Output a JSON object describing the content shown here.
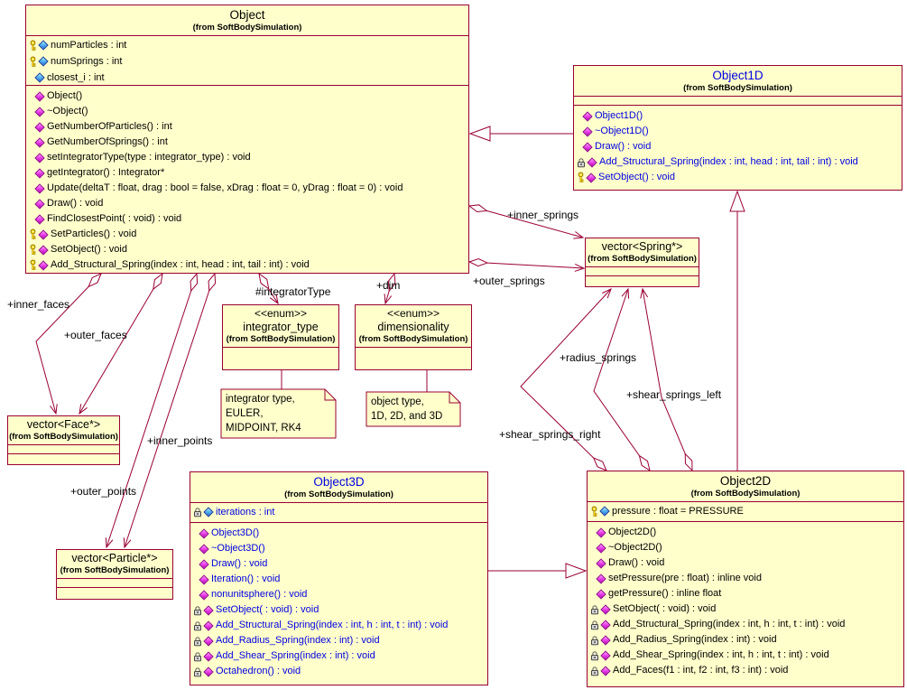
{
  "palette": {
    "box_fill": "#FFFFCC",
    "line_color": "#990033",
    "blue_text": "#0000E0",
    "black_text": "#000000",
    "note_fill": "#FFFFCC"
  },
  "classes": {
    "object": {
      "name": "Object",
      "from": "(from SoftBodySimulation)",
      "name_color": "#000000",
      "text_color": "#000000",
      "attributes": [
        {
          "icons": [
            "key",
            "attr"
          ],
          "text": "numParticles : int"
        },
        {
          "icons": [
            "key",
            "attr"
          ],
          "text": "numSprings : int"
        },
        {
          "icons": [
            "attr"
          ],
          "text": "closest_i : int"
        }
      ],
      "operations": [
        {
          "icons": [
            "op"
          ],
          "text": "Object()"
        },
        {
          "icons": [
            "op"
          ],
          "text": "~Object()"
        },
        {
          "icons": [
            "op"
          ],
          "text": "GetNumberOfParticles() : int"
        },
        {
          "icons": [
            "op"
          ],
          "text": "GetNumberOfSprings() : int"
        },
        {
          "icons": [
            "op"
          ],
          "text": "setIntegratorType(type : integrator_type) : void"
        },
        {
          "icons": [
            "op"
          ],
          "text": "getIntegrator() : Integrator*"
        },
        {
          "icons": [
            "op"
          ],
          "text": "Update(deltaT : float, drag : bool = false, xDrag : float = 0, yDrag : float = 0) : void"
        },
        {
          "icons": [
            "op"
          ],
          "text": "Draw() : void"
        },
        {
          "icons": [
            "op"
          ],
          "text": "FindClosestPoint( : void) : void"
        },
        {
          "icons": [
            "key",
            "op"
          ],
          "text": "SetParticles() : void"
        },
        {
          "icons": [
            "key",
            "op"
          ],
          "text": "SetObject() : void"
        },
        {
          "icons": [
            "key",
            "op"
          ],
          "text": "Add_Structural_Spring(index : int, head : int, tail : int) : void"
        }
      ]
    },
    "object1d": {
      "name": "Object1D",
      "from": "(from SoftBodySimulation)",
      "name_color": "#0000E0",
      "text_color": "#0000E0",
      "attributes": [],
      "operations": [
        {
          "icons": [
            "op"
          ],
          "text": "Object1D()"
        },
        {
          "icons": [
            "op"
          ],
          "text": "~Object1D()"
        },
        {
          "icons": [
            "op"
          ],
          "text": "Draw() : void"
        },
        {
          "icons": [
            "lock",
            "op"
          ],
          "text": "Add_Structural_Spring(index : int, head : int, tail : int) : void"
        },
        {
          "icons": [
            "key",
            "op"
          ],
          "text": "SetObject() : void"
        }
      ]
    },
    "vector_spring": {
      "name": "vector<Spring*>",
      "from": "(from SoftBodySimulation)",
      "name_color": "#000000",
      "text_color": "#000000",
      "attributes": [],
      "operations": []
    },
    "vector_face": {
      "name": "vector<Face*>",
      "from": "(from SoftBodySimulation)",
      "name_color": "#000000",
      "text_color": "#000000",
      "attributes": [],
      "operations": []
    },
    "vector_particle": {
      "name": "vector<Particle*>",
      "from": "(from SoftBodySimulation)",
      "name_color": "#000000",
      "text_color": "#000000",
      "attributes": [],
      "operations": []
    },
    "enum_integrator": {
      "stereotype": "<<enum>>",
      "name": "integrator_type",
      "from": "(from SoftBodySimulation)",
      "name_color": "#000000",
      "text_color": "#000000",
      "attributes": [],
      "operations": []
    },
    "enum_dimensionality": {
      "stereotype": "<<enum>>",
      "name": "dimensionality",
      "from": "(from SoftBodySimulation)",
      "name_color": "#000000",
      "text_color": "#000000",
      "attributes": [],
      "operations": []
    },
    "object3d": {
      "name": "Object3D",
      "from": "(from SoftBodySimulation)",
      "name_color": "#0000E0",
      "text_color": "#0000E0",
      "attributes": [
        {
          "icons": [
            "lock",
            "attr"
          ],
          "text": "iterations : int"
        }
      ],
      "operations": [
        {
          "icons": [
            "op"
          ],
          "text": "Object3D()"
        },
        {
          "icons": [
            "op"
          ],
          "text": "~Object3D()"
        },
        {
          "icons": [
            "op"
          ],
          "text": "Draw() : void"
        },
        {
          "icons": [
            "op"
          ],
          "text": "Iteration() : void"
        },
        {
          "icons": [
            "op"
          ],
          "text": "nonunitsphere() : void"
        },
        {
          "icons": [
            "lock",
            "op"
          ],
          "text": "SetObject( : void) : void"
        },
        {
          "icons": [
            "lock",
            "op"
          ],
          "text": "Add_Structural_Spring(index : int, h : int, t : int) : void"
        },
        {
          "icons": [
            "lock",
            "op"
          ],
          "text": "Add_Radius_Spring(index : int) : void"
        },
        {
          "icons": [
            "lock",
            "op"
          ],
          "text": "Add_Shear_Spring(index : int) : void"
        },
        {
          "icons": [
            "lock",
            "op"
          ],
          "text": "Octahedron() : void"
        }
      ]
    },
    "object2d": {
      "name": "Object2D",
      "from": "(from SoftBodySimulation)",
      "name_color": "#000000",
      "text_color": "#000000",
      "attributes": [
        {
          "icons": [
            "key",
            "attr"
          ],
          "text": "pressure : float = PRESSURE"
        }
      ],
      "operations": [
        {
          "icons": [
            "op"
          ],
          "text": "Object2D()"
        },
        {
          "icons": [
            "op"
          ],
          "text": "~Object2D()"
        },
        {
          "icons": [
            "op"
          ],
          "text": "Draw() : void"
        },
        {
          "icons": [
            "op"
          ],
          "text": "setPressure(pre : float) : inline void"
        },
        {
          "icons": [
            "op"
          ],
          "text": "getPressure() : inline float"
        },
        {
          "icons": [
            "lock",
            "op"
          ],
          "text": "SetObject( : void) : void"
        },
        {
          "icons": [
            "lock",
            "op"
          ],
          "text": "Add_Structural_Spring(index : int, h : int, t : int) : void"
        },
        {
          "icons": [
            "lock",
            "op"
          ],
          "text": "Add_Radius_Spring(index : int) : void"
        },
        {
          "icons": [
            "lock",
            "op"
          ],
          "text": "Add_Shear_Spring(index : int, h : int, t : int) : void"
        },
        {
          "icons": [
            "lock",
            "op"
          ],
          "text": "Add_Faces(f1 : int, f2 : int, f3 : int) : void"
        }
      ]
    }
  },
  "notes": {
    "integrator_note": {
      "lines": [
        "integrator type,",
        "EULER,",
        "MIDPOINT, RK4"
      ]
    },
    "dimensionality_note": {
      "lines": [
        "object type,",
        "1D, 2D, and 3D"
      ]
    }
  },
  "edge_labels": {
    "inner_springs": "+inner_springs",
    "outer_springs": "+outer_springs",
    "inner_faces": "+inner_faces",
    "outer_faces": "+outer_faces",
    "inner_points": "+inner_points",
    "outer_points": "+outer_points",
    "integrator_type_role": "#integratorType",
    "dim": "+dim",
    "radius_springs": "+radius_springs",
    "shear_springs_left": "+shear_springs_left",
    "shear_springs_right": "+shear_springs_right"
  }
}
